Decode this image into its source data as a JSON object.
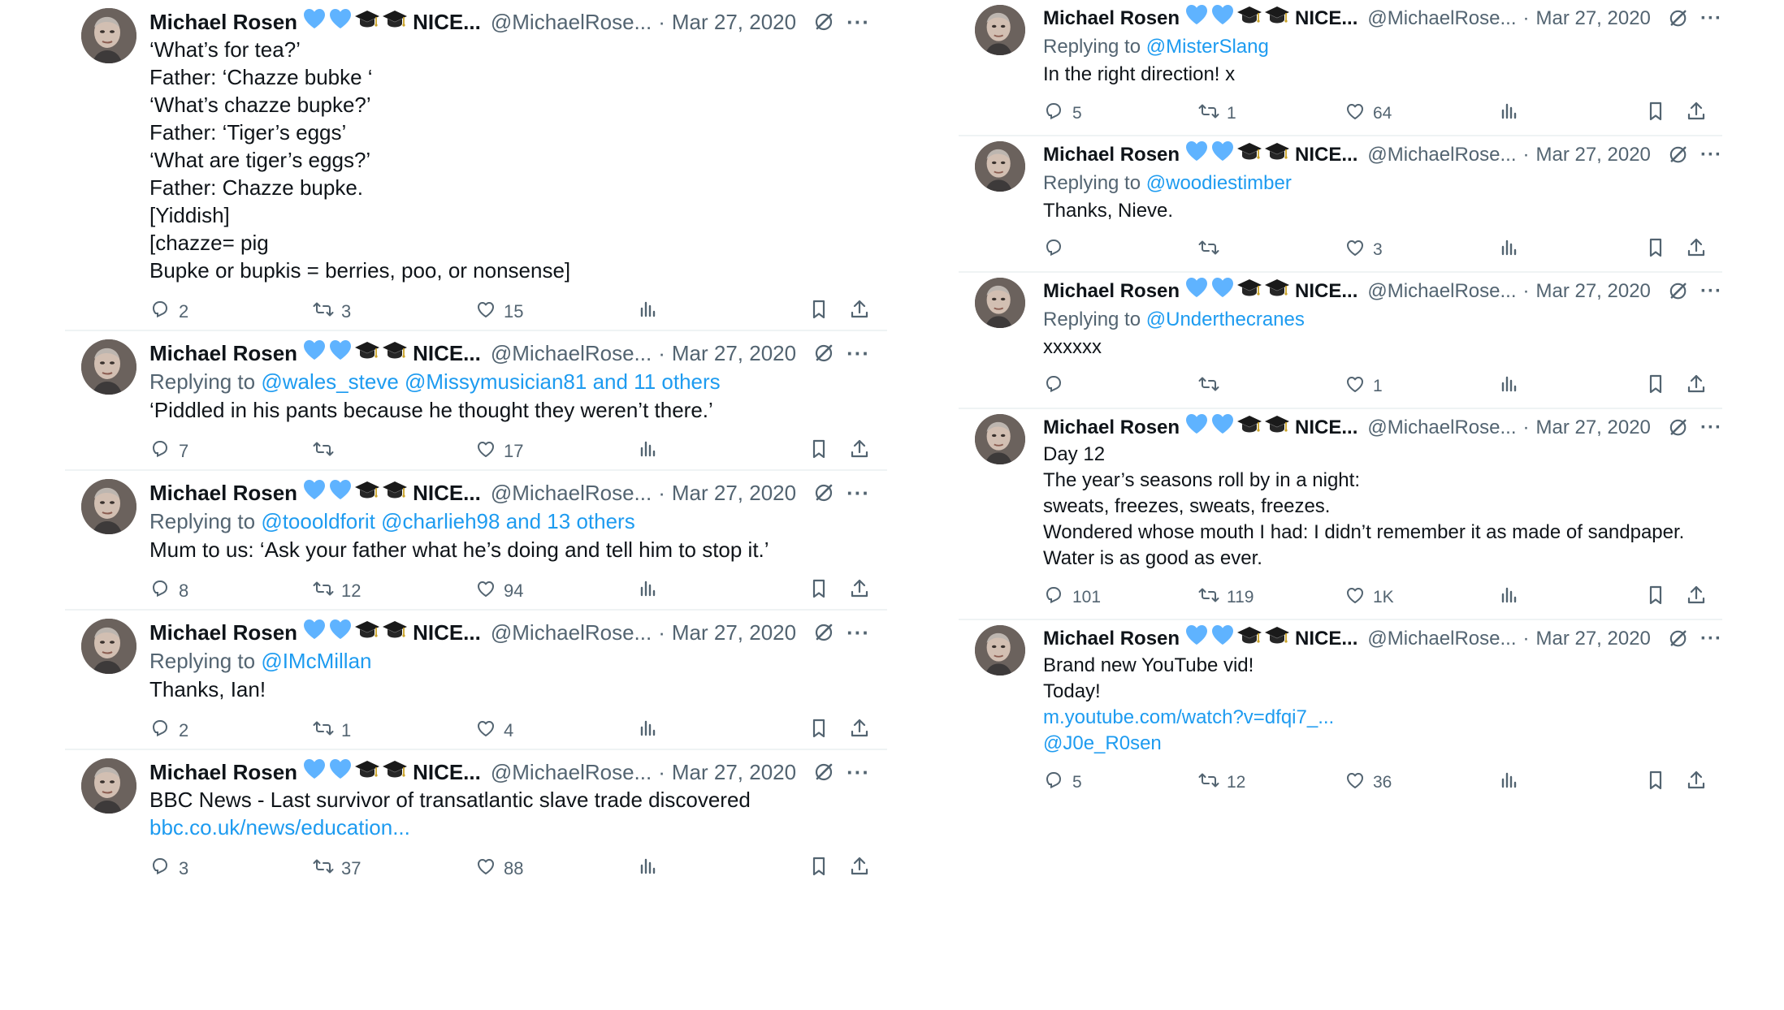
{
  "author": {
    "name": "Michael Rosen",
    "suffix": "NICE...",
    "handle": "@MichaelRose...",
    "date": "Mar 27, 2020"
  },
  "more_glyph": "···",
  "date_sep": "·",
  "colors": {
    "link": "#1d9bf0",
    "muted": "#536471",
    "heart_emoji": "#5fb3ff",
    "separator": "#eff3f4"
  },
  "left_tweets": [
    {
      "body": [
        "‘What’s for tea?’",
        "Father: ‘Chazze bubke ‘",
        "‘What’s chazze bupke?’",
        "Father: ‘Tiger’s eggs’",
        "‘What are tiger’s eggs?’",
        "Father: Chazze bupke.",
        "[Yiddish]",
        "[chazze= pig",
        "Bupke or bupkis = berries, poo, or nonsense]"
      ],
      "replies": "2",
      "retweets": "3",
      "likes": "15"
    },
    {
      "replying_label": "Replying to",
      "replying_to": "@wales_steve @Missymusician81 and 11 others",
      "body": [
        "‘Piddled in his pants because he thought they weren’t there.’"
      ],
      "replies": "7",
      "retweets": "",
      "likes": "17"
    },
    {
      "replying_label": "Replying to",
      "replying_to": "@toooldforit @charlieh98 and 13 others",
      "body": [
        "Mum to us: ‘Ask your father what he’s doing and tell him to stop it.’"
      ],
      "replies": "8",
      "retweets": "12",
      "likes": "94"
    },
    {
      "replying_label": "Replying to",
      "replying_to": "@IMcMillan",
      "body": [
        "Thanks, Ian!"
      ],
      "replies": "2",
      "retweets": "1",
      "likes": "4"
    },
    {
      "body": [
        "BBC News - Last survivor of transatlantic slave trade discovered"
      ],
      "link": "bbc.co.uk/news/education...",
      "replies": "3",
      "retweets": "37",
      "likes": "88"
    }
  ],
  "right_tweets": [
    {
      "replying_label": "Replying to",
      "replying_to": "@MisterSlang",
      "body": [
        "In the right direction! x"
      ],
      "replies": "5",
      "retweets": "1",
      "likes": "64"
    },
    {
      "replying_label": "Replying to",
      "replying_to": "@woodiestimber",
      "body": [
        "Thanks, Nieve."
      ],
      "replies": "",
      "retweets": "",
      "likes": "3"
    },
    {
      "replying_label": "Replying to",
      "replying_to": "@Underthecranes",
      "body": [
        "xxxxxx"
      ],
      "replies": "",
      "retweets": "",
      "likes": "1"
    },
    {
      "body": [
        "Day 12",
        "The year’s seasons roll by in a night:",
        "sweats, freezes, sweats, freezes.",
        "Wondered whose mouth I had: I didn’t remember it as made of sandpaper.",
        "Water is as good as ever."
      ],
      "replies": "101",
      "retweets": "119",
      "likes": "1K"
    },
    {
      "body": [
        "Brand new YouTube vid!",
        "Today!"
      ],
      "link": "m.youtube.com/watch?v=dfqi7_...",
      "mention": "@J0e_R0sen",
      "replies": "5",
      "retweets": "12",
      "likes": "36"
    }
  ]
}
